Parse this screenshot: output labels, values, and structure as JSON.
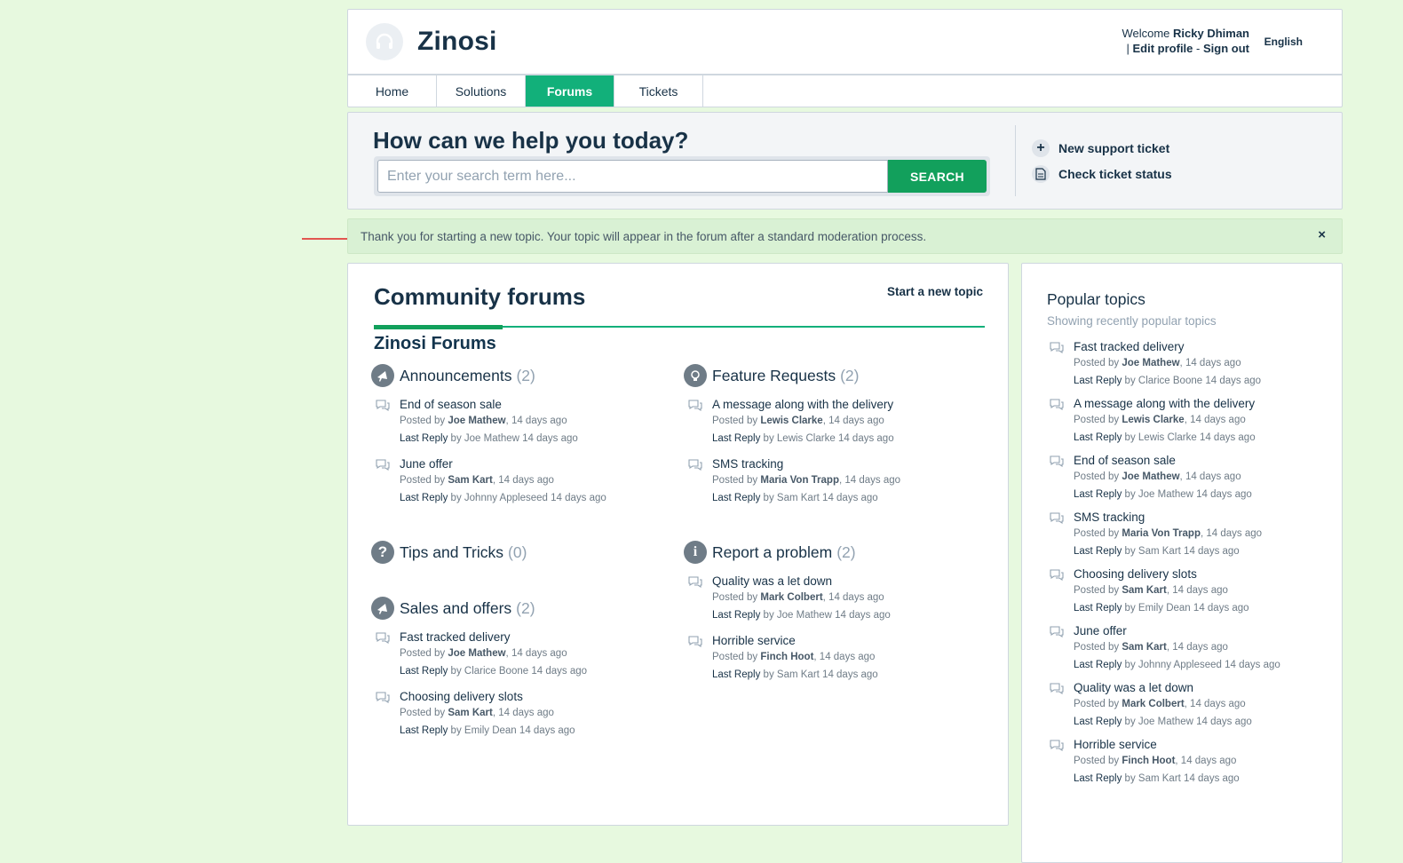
{
  "header": {
    "brand": "Zinosi",
    "welcome": "Welcome",
    "user_name": "Ricky Dhiman",
    "separator": "|",
    "edit_profile": "Edit profile",
    "dash": "-",
    "sign_out": "Sign out",
    "language": "English"
  },
  "nav": {
    "tabs": [
      {
        "label": "Home"
      },
      {
        "label": "Solutions"
      },
      {
        "label": "Forums"
      },
      {
        "label": "Tickets"
      }
    ],
    "active": "Forums"
  },
  "hero": {
    "title": "How can we help you today?",
    "search_placeholder": "Enter your search term here...",
    "search_button": "SEARCH",
    "new_ticket": "New support ticket",
    "check_status": "Check ticket status"
  },
  "notice": {
    "text": "Thank you for starting a new topic. Your topic will appear in the forum after a standard moderation process.",
    "close": "×"
  },
  "main": {
    "title": "Community forums",
    "start_topic": "Start a new topic",
    "forum_title": "Zinosi Forums",
    "posted_by": "Posted by",
    "last_reply": "Last Reply",
    "by": "by",
    "categories": [
      {
        "name": "Announcements",
        "count": "(2)",
        "icon": "megaphone-icon",
        "topics": [
          {
            "title": "End of season sale",
            "author": "Joe Mathew",
            "posted": "14 days ago",
            "reply_by": "Joe Mathew",
            "reply_time": "14 days ago"
          },
          {
            "title": "June offer",
            "author": "Sam Kart",
            "posted": "14 days ago",
            "reply_by": "Johnny Appleseed",
            "reply_time": "14 days ago"
          }
        ]
      },
      {
        "name": "Feature Requests",
        "count": "(2)",
        "icon": "lightbulb-icon",
        "topics": [
          {
            "title": "A message along with the delivery",
            "author": "Lewis Clarke",
            "posted": "14 days ago",
            "reply_by": "Lewis Clarke",
            "reply_time": "14 days ago"
          },
          {
            "title": "SMS tracking",
            "author": "Maria Von Trapp",
            "posted": "14 days ago",
            "reply_by": "Sam Kart",
            "reply_time": "14 days ago"
          }
        ]
      },
      {
        "name": "Tips and Tricks",
        "count": "(0)",
        "icon": "question-icon",
        "topics": []
      },
      {
        "name": "Report a problem",
        "count": "(2)",
        "icon": "info-icon",
        "topics": [
          {
            "title": "Quality was a let down",
            "author": "Mark Colbert",
            "posted": "14 days ago",
            "reply_by": "Joe Mathew",
            "reply_time": "14 days ago"
          },
          {
            "title": "Horrible service",
            "author": "Finch Hoot",
            "posted": "14 days ago",
            "reply_by": "Sam Kart",
            "reply_time": "14 days ago"
          }
        ]
      },
      {
        "name": "Sales and offers",
        "count": "(2)",
        "icon": "megaphone-icon",
        "topics": [
          {
            "title": "Fast tracked delivery",
            "author": "Joe Mathew",
            "posted": "14 days ago",
            "reply_by": "Clarice Boone",
            "reply_time": "14 days ago"
          },
          {
            "title": "Choosing delivery slots",
            "author": "Sam Kart",
            "posted": "14 days ago",
            "reply_by": "Emily Dean",
            "reply_time": "14 days ago"
          }
        ]
      }
    ]
  },
  "sidebar": {
    "title": "Popular topics",
    "subtitle": "Showing recently popular topics",
    "topics": [
      {
        "title": "Fast tracked delivery",
        "author": "Joe Mathew",
        "posted": "14 days ago",
        "reply_by": "Clarice Boone",
        "reply_time": "14 days ago"
      },
      {
        "title": "A message along with the delivery",
        "author": "Lewis Clarke",
        "posted": "14 days ago",
        "reply_by": "Lewis Clarke",
        "reply_time": "14 days ago"
      },
      {
        "title": "End of season sale",
        "author": "Joe Mathew",
        "posted": "14 days ago",
        "reply_by": "Joe Mathew",
        "reply_time": "14 days ago"
      },
      {
        "title": "SMS tracking",
        "author": "Maria Von Trapp",
        "posted": "14 days ago",
        "reply_by": "Sam Kart",
        "reply_time": "14 days ago"
      },
      {
        "title": "Choosing delivery slots",
        "author": "Sam Kart",
        "posted": "14 days ago",
        "reply_by": "Emily Dean",
        "reply_time": "14 days ago"
      },
      {
        "title": "June offer",
        "author": "Sam Kart",
        "posted": "14 days ago",
        "reply_by": "Johnny Appleseed",
        "reply_time": "14 days ago"
      },
      {
        "title": "Quality was a let down",
        "author": "Mark Colbert",
        "posted": "14 days ago",
        "reply_by": "Joe Mathew",
        "reply_time": "14 days ago"
      },
      {
        "title": "Horrible service",
        "author": "Finch Hoot",
        "posted": "14 days ago",
        "reply_by": "Sam Kart",
        "reply_time": "14 days ago"
      }
    ]
  },
  "colors": {
    "page_bg": "#e7f9df",
    "accent": "#12b07a",
    "search_button": "#12a05c",
    "notice_bg": "#d9f1d4",
    "arrow": "#e02020"
  }
}
